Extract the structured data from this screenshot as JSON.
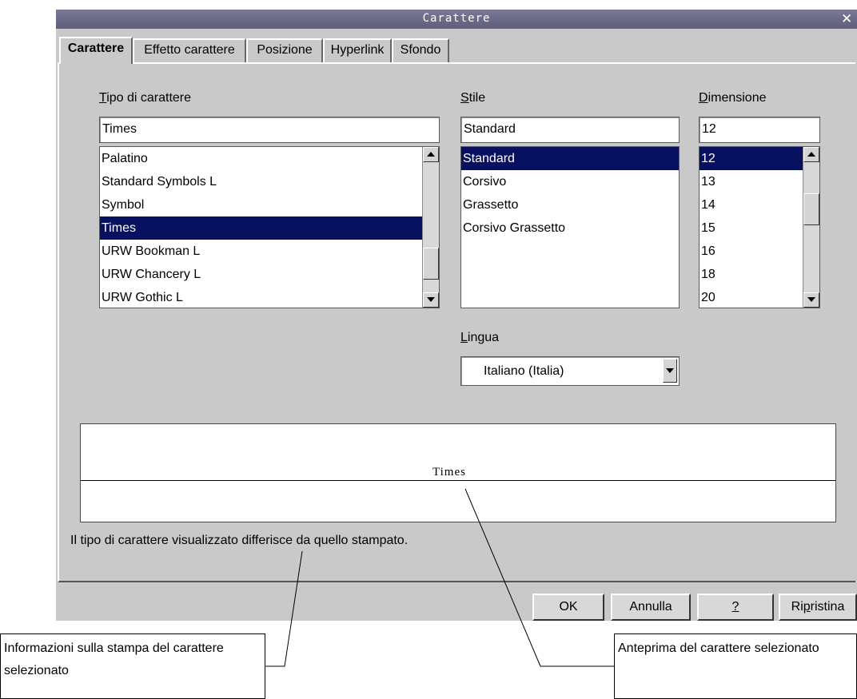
{
  "window": {
    "title": "Carattere",
    "close_glyph": "✕"
  },
  "tabs": [
    {
      "label": "Carattere",
      "active": true
    },
    {
      "label": "Effetto carattere"
    },
    {
      "label": "Posizione"
    },
    {
      "label": "Hyperlink"
    },
    {
      "label": "Sfondo"
    }
  ],
  "font": {
    "label_mnemonic": "T",
    "label_rest": "ipo di carattere",
    "value": "Times",
    "items": [
      "Palatino",
      "Standard Symbols L",
      "Symbol",
      "Times",
      "URW Bookman L",
      "URW Chancery L",
      "URW Gothic L"
    ],
    "selected": "Times"
  },
  "style": {
    "label_mnemonic": "S",
    "label_rest": "tile",
    "value": "Standard",
    "items": [
      "Standard",
      "Corsivo",
      "Grassetto",
      "Corsivo Grassetto"
    ],
    "selected": "Standard"
  },
  "size": {
    "label_mnemonic": "D",
    "label_rest": "imensione",
    "value": "12",
    "items": [
      "12",
      "13",
      "14",
      "15",
      "16",
      "18",
      "20"
    ],
    "selected": "12"
  },
  "language": {
    "label_mnemonic": "L",
    "label_rest": "ingua",
    "value": "Italiano (Italia)"
  },
  "preview": {
    "text": "Times"
  },
  "info_text": "Il tipo di carattere visualizzato differisce da quello stampato.",
  "buttons": {
    "ok": "OK",
    "cancel": "Annulla",
    "help": "?",
    "reset_before": "Ri",
    "reset_mnemonic": "p",
    "reset_after": "ristina"
  },
  "callouts": {
    "left": "Informazioni sulla stampa del carattere selezionato",
    "right": "Anteprima del carattere selezionato"
  },
  "icons": {
    "close": "close-icon",
    "scroll_up": "scroll-up-icon",
    "scroll_down": "scroll-down-icon",
    "dropdown": "chevron-down-icon"
  },
  "colors": {
    "selection": "#081060",
    "titlebar": "#5d5d7d",
    "dialog_bg": "#c9c9c9"
  }
}
